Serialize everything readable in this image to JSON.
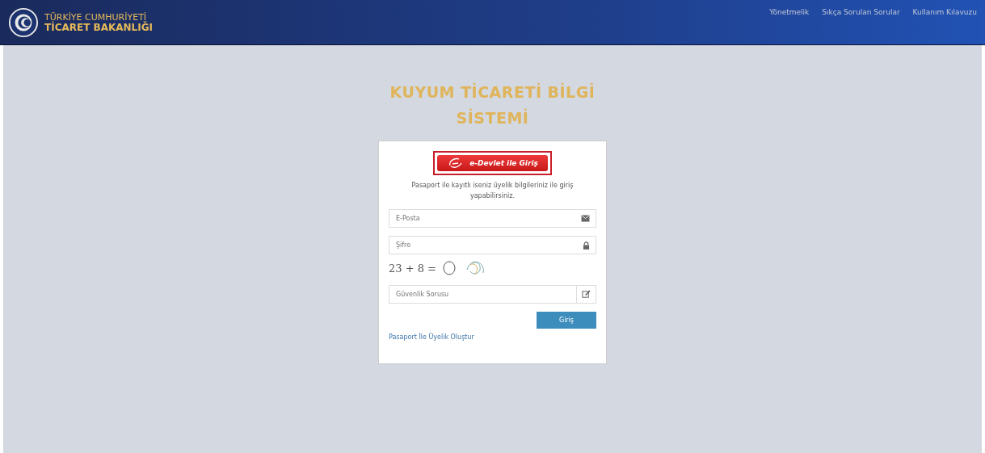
{
  "header": {
    "ministry_line1": "TÜRKİYE CUMHURİYETİ",
    "ministry_line2": "TİCARET BAKANLIĞI",
    "nav": [
      "Yönetmelik",
      "Sıkça Sorulan Sorular",
      "Kullanım Kılavuzu"
    ]
  },
  "title": "KUYUM TİCARETİ BİLGİ SİSTEMİ",
  "login": {
    "edevlet_button": "e-Devlet ile Giriş",
    "info": "Pasaport ile kayıtlı iseniz üyelik bilgileriniz ile giriş yapabilirsiniz.",
    "fields": [
      {
        "kind": "email",
        "placeholder": "E-Posta"
      },
      {
        "kind": "password",
        "placeholder": "Şifre"
      }
    ],
    "captcha": "23 + 8 =",
    "security_field": {
      "placeholder": "Güvenlik Sorusu"
    },
    "submit": "Giriş",
    "register_link": "Pasaport İle Üyelik Oluştur"
  }
}
